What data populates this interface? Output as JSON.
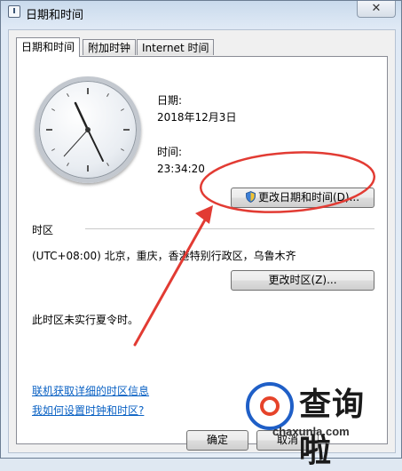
{
  "window": {
    "title": "日期和时间",
    "close_glyph": "✕"
  },
  "tabs": [
    {
      "label": "日期和时间",
      "active": true
    },
    {
      "label": "附加时钟",
      "active": false
    },
    {
      "label": "Internet 时间",
      "active": false
    }
  ],
  "datetime": {
    "date_label": "日期:",
    "date_value": "2018年12月3日",
    "time_label": "时间:",
    "time_value": "23:34:20",
    "change_button": "更改日期和时间(D)..."
  },
  "timezone": {
    "section_label": "时区",
    "value": "(UTC+08:00) 北京，重庆，香港特别行政区，乌鲁木齐",
    "change_button": "更改时区(Z)...",
    "dst_note": "此时区未实行夏令时。"
  },
  "links": {
    "online_info": "联机获取详细的时区信息",
    "how_to": "我如何设置时钟和时区?"
  },
  "footer": {
    "ok_button": "确定",
    "cancel_button": "取消"
  },
  "watermark": {
    "brand": "查询啦",
    "url": "chaxunla.com"
  },
  "colors": {
    "annotation": "#e23b33",
    "link": "#0b62c4",
    "brand_blue": "#1f5fc7",
    "brand_red": "#e6432a"
  },
  "icons": {
    "shield": "shield-icon",
    "clock": "analog-clock",
    "window": "clock-window-icon"
  }
}
